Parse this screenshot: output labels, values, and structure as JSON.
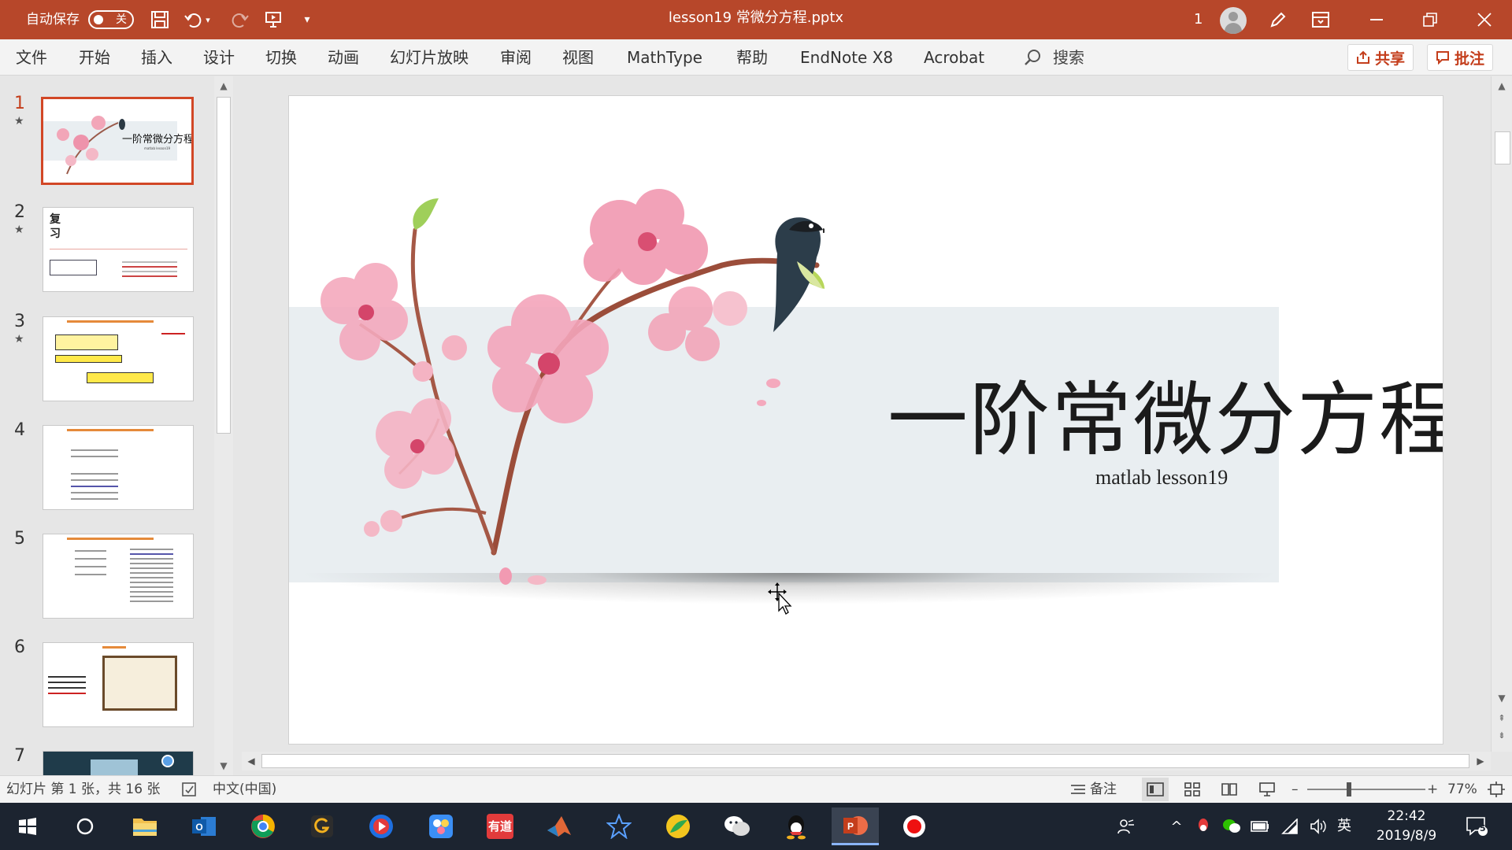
{
  "titlebar": {
    "autosave_label": "自动保存",
    "autosave_state": "关",
    "document_title": "lesson19 常微分方程.pptx",
    "user_count": "1",
    "colors": {
      "background": "#b7472a",
      "text": "#ffffff"
    }
  },
  "ribbon": {
    "tabs": [
      "文件",
      "开始",
      "插入",
      "设计",
      "切换",
      "动画",
      "幻灯片放映",
      "审阅",
      "视图",
      "MathType",
      "帮助",
      "EndNote X8",
      "Acrobat"
    ],
    "search_label": "搜索",
    "share_label": "共享",
    "comment_label": "批注",
    "accent_color": "#c43e1c"
  },
  "thumbnails": [
    {
      "number": "1",
      "starred": true,
      "selected": true,
      "title": "一阶常微分方程",
      "subtitle": "matlab lesson19"
    },
    {
      "number": "2",
      "starred": true,
      "selected": false,
      "title": "复",
      "title2": "习"
    },
    {
      "number": "3",
      "starred": true,
      "selected": false
    },
    {
      "number": "4",
      "starred": false,
      "selected": false
    },
    {
      "number": "5",
      "starred": false,
      "selected": false
    },
    {
      "number": "6",
      "starred": false,
      "selected": false
    },
    {
      "number": "7",
      "starred": false,
      "selected": false
    }
  ],
  "slide": {
    "title": "一阶常微分方程",
    "subtitle": "matlab lesson19"
  },
  "statusbar": {
    "slide_info": "幻灯片 第 1 张，共 16 张",
    "language": "中文(中国)",
    "notes_label": "备注",
    "zoom_minus": "–",
    "zoom_plus": "+",
    "zoom_level": "77%",
    "zoom_fraction": 0.35
  },
  "taskbar": {
    "apps": [
      "start-icon",
      "cortana-icon",
      "file-explorer-icon",
      "outlook-icon",
      "chrome-icon",
      "app-g-icon",
      "media-player-icon",
      "app-blue-icon",
      "youdao-icon",
      "matlab-icon",
      "app-star-icon",
      "app-green-icon",
      "wechat-icon",
      "qq-icon",
      "powerpoint-icon",
      "record-icon"
    ],
    "youdao_label": "有道",
    "ime_label": "英",
    "time": "22:42",
    "date": "2019/8/9",
    "notification_count": "5"
  }
}
